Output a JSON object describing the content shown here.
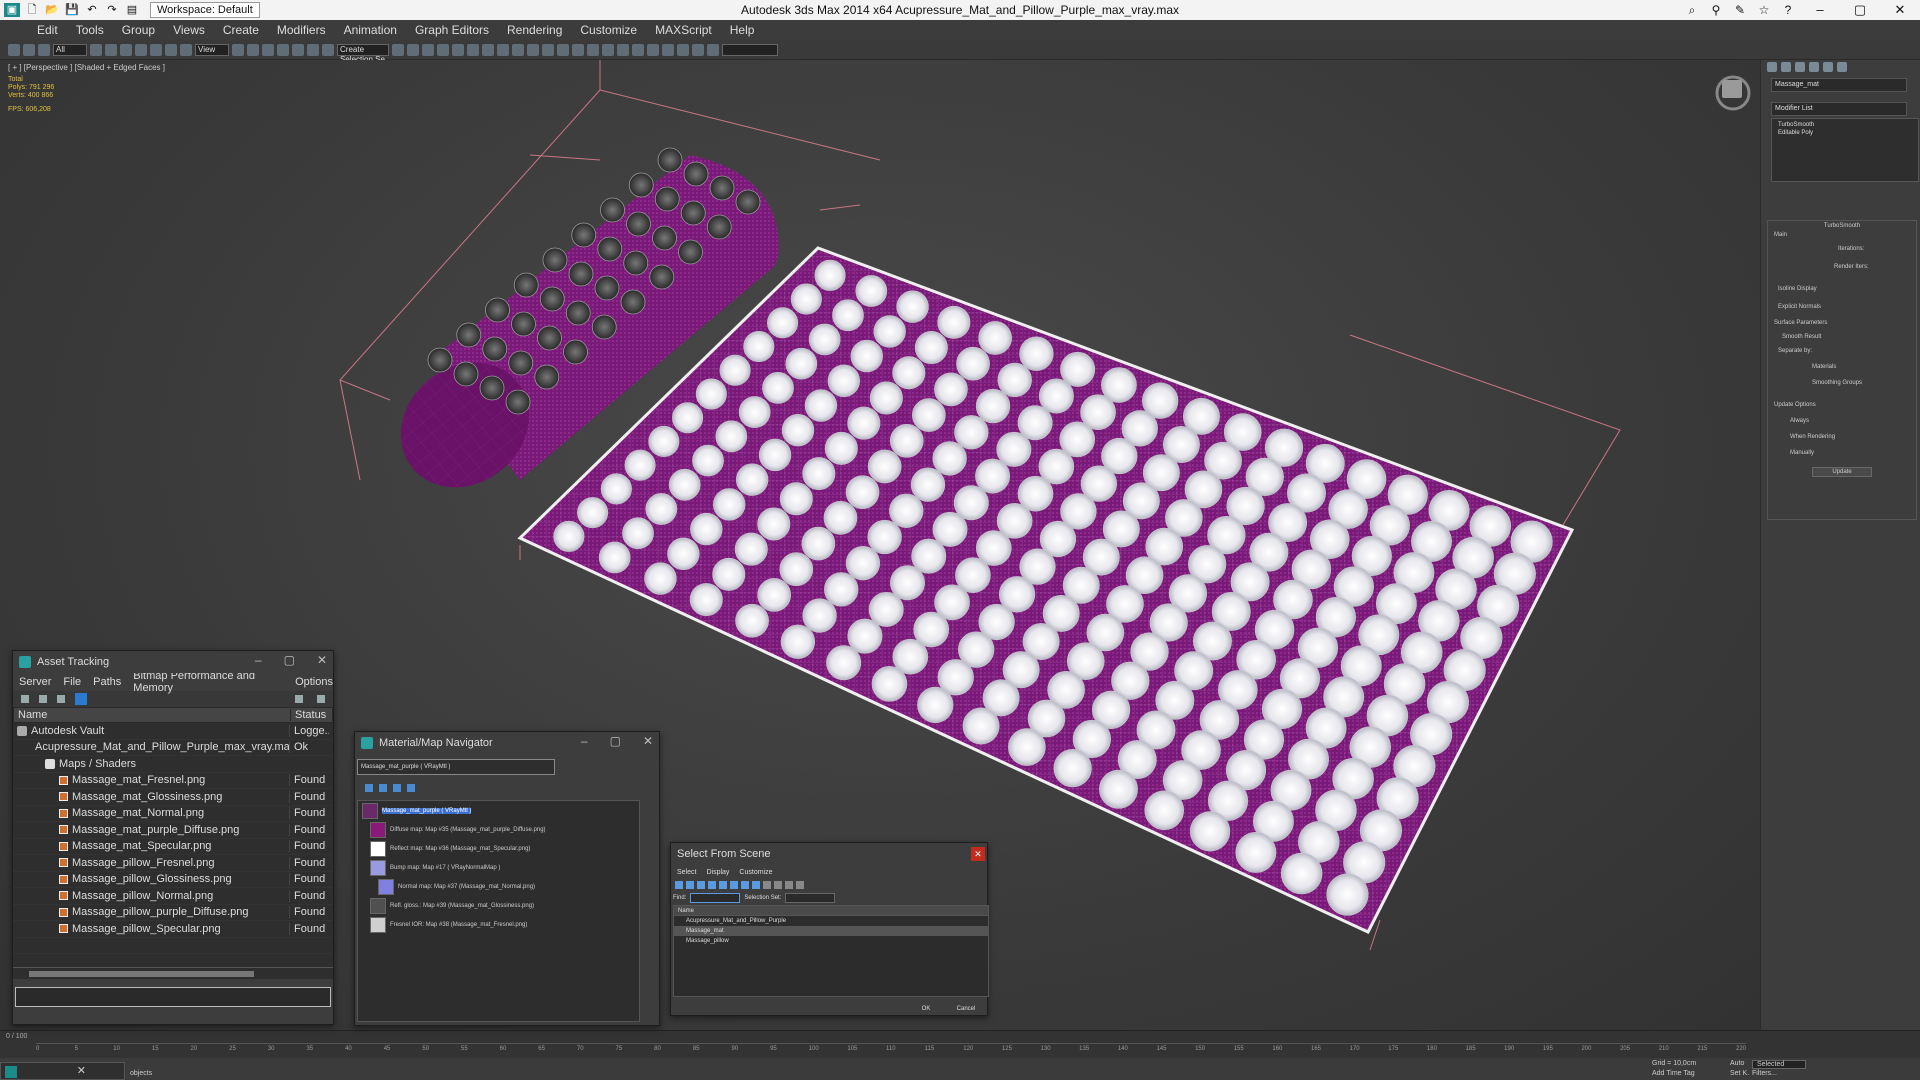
{
  "titlebar": {
    "workspace": "Workspace: Default",
    "title": "Autodesk 3ds Max  2014 x64     Acupressure_Mat_and_Pillow_Purple_max_vray.max"
  },
  "menu": [
    "Edit",
    "Tools",
    "Group",
    "Views",
    "Create",
    "Modifiers",
    "Animation",
    "Graph Editors",
    "Rendering",
    "Customize",
    "MAXScript",
    "Help"
  ],
  "toolbar": {
    "selection_filter": "All",
    "ref_coord": "View",
    "named_sel": "Create Selection Se"
  },
  "viewport": {
    "label": "[ + ] [Perspective ] [Shaded + Edged Faces ]",
    "stats": {
      "total": "Total",
      "polys_label": "Polys:",
      "polys": "791 296",
      "verts_label": "Verts:",
      "verts": "400 866",
      "fps_label": "FPS:",
      "fps": "606,208"
    }
  },
  "command_panel": {
    "object_name": "Massage_mat",
    "modifier_list": "Modifier List",
    "stack": [
      "TurboSmooth",
      "Editable Poly"
    ],
    "turbosmooth": {
      "title": "TurboSmooth",
      "main": "Main",
      "iterations": "Iterations:",
      "render_iters": "Render Iters:",
      "isoline": "Isoline Display",
      "explicit": "Explicit Normals",
      "surface": "Surface Parameters",
      "smooth_result": "Smooth Result",
      "separate": "Separate by:",
      "materials": "Materials",
      "smoothing": "Smoothing Groups",
      "update_options": "Update Options",
      "always": "Always",
      "when_rendering": "When Rendering",
      "manually": "Manually",
      "update_btn": "Update"
    }
  },
  "asset_tracking": {
    "title": "Asset Tracking",
    "menu": [
      "Server",
      "File",
      "Paths",
      "Bitmap Performance and Memory",
      "Options"
    ],
    "col_name": "Name",
    "col_status": "Status",
    "rows": [
      {
        "name": "Autodesk Vault",
        "status": "Logge...",
        "indent": 0,
        "kind": "vault"
      },
      {
        "name": "Acupressure_Mat_and_Pillow_Purple_max_vray.max",
        "status": "Ok",
        "indent": 1,
        "kind": "max"
      },
      {
        "name": "Maps / Shaders",
        "status": "",
        "indent": 2,
        "kind": "folder"
      },
      {
        "name": "Massage_mat_Fresnel.png",
        "status": "Found",
        "indent": 3,
        "kind": "file"
      },
      {
        "name": "Massage_mat_Glossiness.png",
        "status": "Found",
        "indent": 3,
        "kind": "file"
      },
      {
        "name": "Massage_mat_Normal.png",
        "status": "Found",
        "indent": 3,
        "kind": "file"
      },
      {
        "name": "Massage_mat_purple_Diffuse.png",
        "status": "Found",
        "indent": 3,
        "kind": "file"
      },
      {
        "name": "Massage_mat_Specular.png",
        "status": "Found",
        "indent": 3,
        "kind": "file"
      },
      {
        "name": "Massage_pillow_Fresnel.png",
        "status": "Found",
        "indent": 3,
        "kind": "file"
      },
      {
        "name": "Massage_pillow_Glossiness.png",
        "status": "Found",
        "indent": 3,
        "kind": "file"
      },
      {
        "name": "Massage_pillow_Normal.png",
        "status": "Found",
        "indent": 3,
        "kind": "file"
      },
      {
        "name": "Massage_pillow_purple_Diffuse.png",
        "status": "Found",
        "indent": 3,
        "kind": "file"
      },
      {
        "name": "Massage_pillow_Specular.png",
        "status": "Found",
        "indent": 3,
        "kind": "file"
      }
    ]
  },
  "material_navigator": {
    "title": "Material/Map Navigator",
    "field": "Massage_mat_purple  ( VRayMtl )",
    "items": [
      {
        "label": "Massage_mat_purple  ( VRayMtl )",
        "swatch": "#6a2a6a",
        "selected": true
      },
      {
        "label": "Diffuse map: Map #35 (Massage_mat_purple_Diffuse.png)",
        "swatch": "#8a1a7a"
      },
      {
        "label": "Reflect map: Map #36 (Massage_mat_Specular.png)",
        "swatch": "#ffffff"
      },
      {
        "label": "Bump map: Map #17  ( VRayNormalMap )",
        "swatch": "#9a9ae0"
      },
      {
        "label": "Normal map: Map #37 (Massage_mat_Normal.png)",
        "swatch": "#8080e0"
      },
      {
        "label": "Refl. gloss.: Map #39 (Massage_mat_Glossiness.png)",
        "swatch": "#505050"
      },
      {
        "label": "Fresnel IOR: Map #38 (Massage_mat_Fresnel.png)",
        "swatch": "#d0d0d0"
      }
    ]
  },
  "select_from_scene": {
    "title": "Select From Scene",
    "tabs": [
      "Select",
      "Display",
      "Customize"
    ],
    "find_label": "Find:",
    "selection_set_label": "Selection Set:",
    "col_name": "Name",
    "items": [
      "Acupressure_Mat_and_Pillow_Purple",
      "Massage_mat",
      "Massage_pillow"
    ],
    "ok": "OK",
    "cancel": "Cancel"
  },
  "timeline": {
    "frame": "0 / 100",
    "ticks": [
      "0",
      "5",
      "10",
      "15",
      "20",
      "25",
      "30",
      "35",
      "40",
      "45",
      "50",
      "55",
      "60",
      "65",
      "70",
      "75",
      "80",
      "85",
      "90",
      "95",
      "100",
      "105",
      "110",
      "115",
      "120",
      "125",
      "130",
      "135",
      "140",
      "145",
      "150",
      "155",
      "160",
      "165",
      "170",
      "175",
      "180",
      "185",
      "190",
      "195",
      "200",
      "205",
      "210",
      "215",
      "220"
    ]
  },
  "statusbar": {
    "objects": "objects",
    "grid": "Grid = 10,0cm",
    "auto": "Auto",
    "selected": "Selected",
    "setk": "Set K.",
    "filters": "Filters...",
    "add_time_tag": "Add Time Tag"
  }
}
